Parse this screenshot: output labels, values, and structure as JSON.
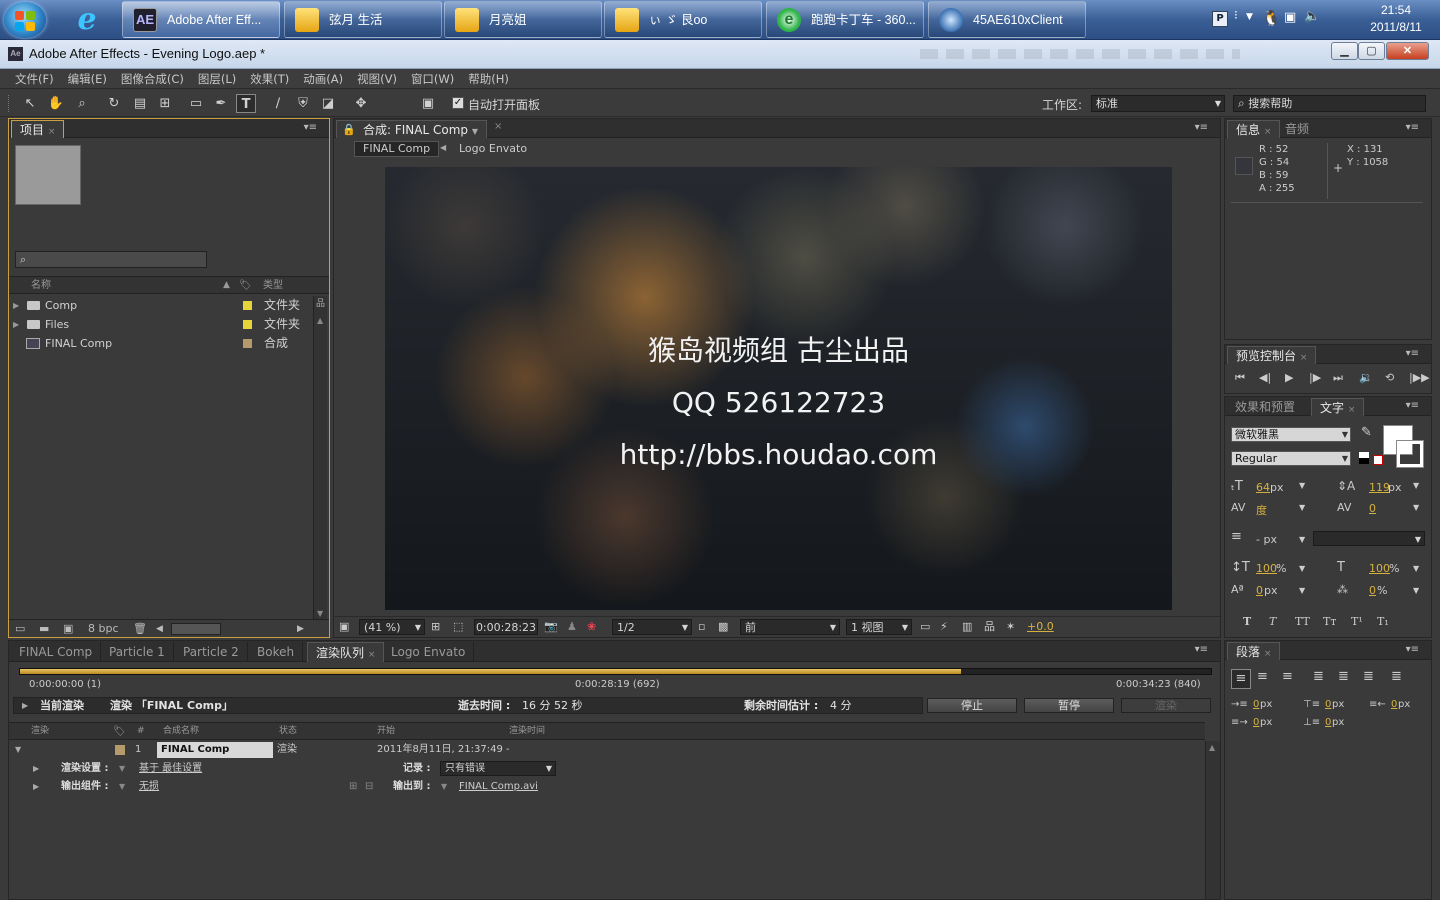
{
  "taskbar": {
    "tasks": [
      {
        "label": "Adobe After Eff...",
        "active": true
      },
      {
        "label": "弦月 生活"
      },
      {
        "label": "月亮姐"
      },
      {
        "label": "ぃ ゞ 艮oo"
      },
      {
        "label": "跑跑卡丁车 - 360..."
      },
      {
        "label": "45AE610xClient"
      }
    ],
    "clock_time": "21:54",
    "clock_date": "2011/8/11"
  },
  "window": {
    "title": "Adobe After Effects - Evening Logo.aep *",
    "app_icon": "Ae"
  },
  "menu": [
    "文件(F)",
    "编辑(E)",
    "图像合成(C)",
    "图层(L)",
    "效果(T)",
    "动画(A)",
    "视图(V)",
    "窗口(W)",
    "帮助(H)"
  ],
  "toolbar": {
    "auto_open_label": "自动打开面板",
    "workspace_label": "工作区:",
    "workspace_value": "标准",
    "search_placeholder": "搜索帮助"
  },
  "project_panel": {
    "tab": "项目",
    "col_name": "名称",
    "col_type": "类型",
    "items": [
      {
        "name": "Comp",
        "type": "文件夹",
        "label_color": "#e6d53a"
      },
      {
        "name": "Files",
        "type": "文件夹",
        "label_color": "#e6d53a"
      },
      {
        "name": "FINAL Comp",
        "type": "合成",
        "label_color": "#b59a6b"
      }
    ],
    "bpc": "8 bpc"
  },
  "comp_panel": {
    "tab": "合成: FINAL Comp",
    "breadcrumb": [
      "FINAL Comp",
      "Logo Envato"
    ],
    "overlay_lines": [
      "猴岛视频组 古尘出品",
      "QQ 526122723",
      "http://bbs.houdao.com"
    ],
    "zoom": "(41 %)",
    "timecode": "0:00:28:23",
    "resolution": "1/2",
    "view_mode": "前",
    "views": "1 视图",
    "exposure": "+0.0"
  },
  "info_panel": {
    "tabs": [
      "信息",
      "音频"
    ],
    "r": "R : 52",
    "g": "G : 54",
    "b": "B : 59",
    "a": "A : 255",
    "x": "X : 131",
    "y": "Y : 1058",
    "swatch": "#34363b"
  },
  "preview_panel": {
    "tab": "预览控制台"
  },
  "char_panel": {
    "tabs": [
      "效果和预置",
      "文字"
    ],
    "font": "微软雅黑",
    "style": "Regular",
    "size": "64",
    "size_unit": "px",
    "leading": "119",
    "leading_unit": "px",
    "kerning": "度",
    "tracking": "0",
    "stroke": "- px",
    "v_scale": "100",
    "h_scale": "100",
    "baseline": "0",
    "tsume": "0",
    "pct": "%",
    "px": "px"
  },
  "para_panel": {
    "tab": "段落",
    "values": [
      "0",
      "0",
      "0",
      "0",
      "0"
    ],
    "unit": "px"
  },
  "bottom_tabs": [
    "FINAL Comp",
    "Particle 1",
    "Particle 2",
    "Bokeh",
    "渲染队列",
    "Logo Envato"
  ],
  "render_queue": {
    "time_start": "0:00:00:00 (1)",
    "time_mid": "0:00:28:19 (692)",
    "time_end": "0:00:34:23 (840)",
    "progress": 0.79,
    "current_label": "当前渲染",
    "rendering_label": "渲染 「FINAL Comp」",
    "elapsed_label": "逝去时间 :",
    "elapsed_value": "16 分 52 秒",
    "remain_label": "剩余时间估计 :",
    "remain_value": "4 分",
    "btn_stop": "停止",
    "btn_pause": "暂停",
    "btn_render": "渲染",
    "cols": [
      "渲染",
      "#",
      "合成名称",
      "状态",
      "开始",
      "渲染时间"
    ],
    "row": {
      "num": "1",
      "comp": "FINAL Comp",
      "status": "渲染",
      "start": "2011年8月11日, 21:37:49",
      "time": "-"
    },
    "settings_label": "渲染设置 :",
    "settings_value": "基于 最佳设置",
    "log_label": "记录 :",
    "log_value": "只有错误",
    "output_module_label": "输出组件 :",
    "output_module_value": "无损",
    "output_to_label": "输出到 :",
    "output_to_value": "FINAL Comp.avi"
  }
}
